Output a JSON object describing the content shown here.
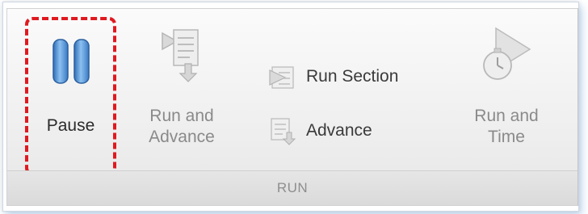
{
  "toolstrip": {
    "section_label": "RUN",
    "buttons": {
      "pause": {
        "label": "Pause",
        "icon": "pause-icon"
      },
      "run_and_advance": {
        "line1": "Run and",
        "line2": "Advance",
        "icon": "run-and-advance-icon"
      },
      "run_section": {
        "label": "Run Section",
        "icon": "run-section-icon"
      },
      "advance": {
        "label": "Advance",
        "icon": "advance-icon"
      },
      "run_and_time": {
        "line1": "Run and",
        "line2": "Time",
        "icon": "run-and-time-icon"
      }
    },
    "colors": {
      "highlight_border": "#e0191f",
      "pause_icon": "#4a90d9",
      "disabled_text": "#8a8a8a"
    }
  }
}
